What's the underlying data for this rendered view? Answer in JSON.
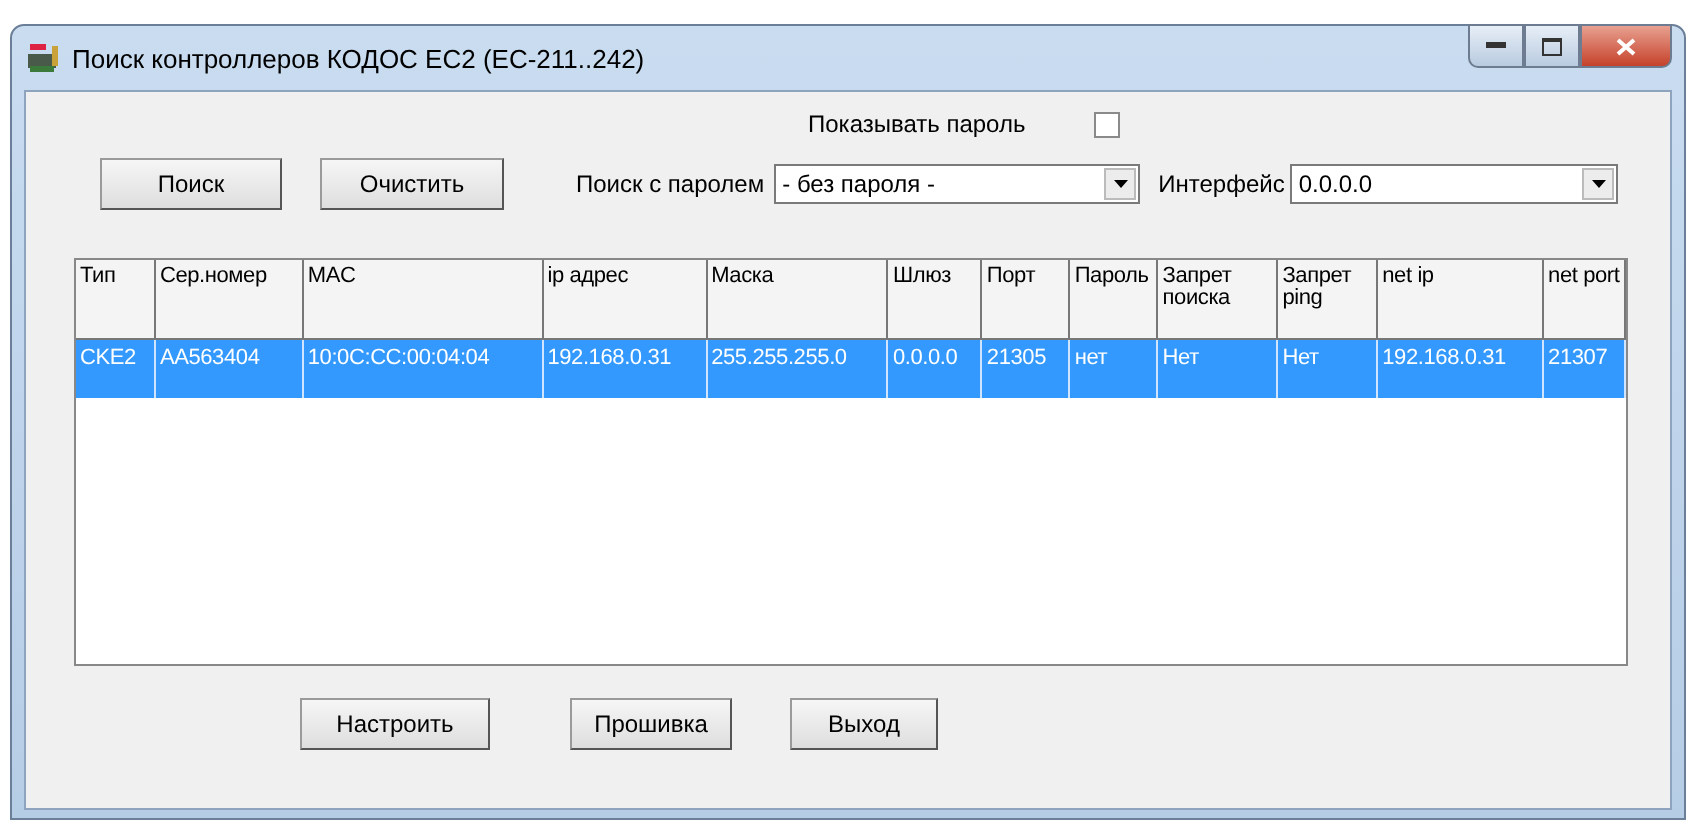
{
  "window": {
    "title": "Поиск контроллеров КОДОС EC2 (EC-211..242)"
  },
  "show_password": {
    "label": "Показывать пароль",
    "checked": false
  },
  "buttons_top": [
    "Поиск",
    "Очистить"
  ],
  "password_search": {
    "label": "Поиск с паролем",
    "value": "- без пароля -"
  },
  "interface": {
    "label": "Интерфейс",
    "value": "0.0.0.0"
  },
  "table": {
    "columns": [
      "Тип",
      "Сер.номер",
      "MAC",
      "ip адрес",
      "Маска",
      "Шлюз",
      "Порт",
      "Пароль",
      "Запрет поиска",
      "Запрет ping",
      "net ip",
      "net port"
    ],
    "rows": [
      {
        "selected": true,
        "cells": [
          "CKE2",
          "AA563404",
          "10:0C:CC:00:04:04",
          "192.168.0.31",
          "255.255.255.0",
          "0.0.0.0",
          "21305",
          "нет",
          "Нет",
          "Нет",
          "192.168.0.31",
          "21307"
        ]
      }
    ]
  },
  "buttons_bottom": [
    "Настроить",
    "Прошивка",
    "Выход"
  ]
}
